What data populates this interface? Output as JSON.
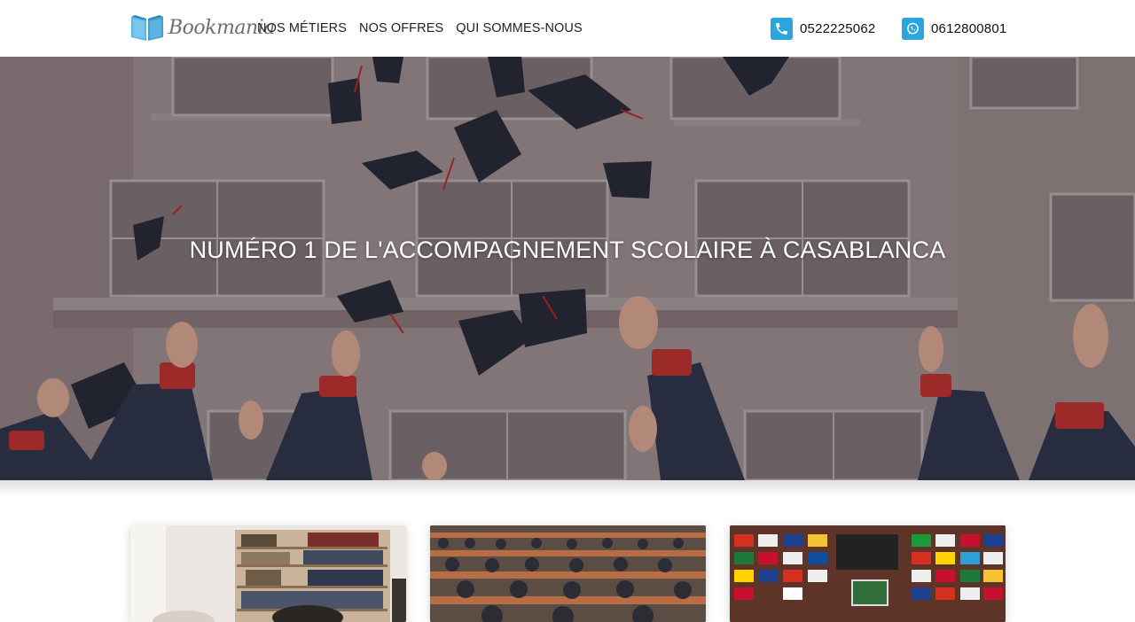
{
  "header": {
    "logo": {
      "text": "Bookmania",
      "icon": "book-logo-icon"
    },
    "nav": [
      {
        "label": "NOS MÉTIERS"
      },
      {
        "label": "NOS OFFRES"
      },
      {
        "label": "QUI SOMMES-NOUS"
      }
    ],
    "contacts": [
      {
        "icon": "phone-icon",
        "number": "0522225062"
      },
      {
        "icon": "whatsapp-icon",
        "number": "0612800801"
      }
    ]
  },
  "hero": {
    "title": "NUMÉRO 1 DE L'ACCOMPAGNEMENT SCOLAIRE À CASABLANCA",
    "image": "graduation-caps-thrown-photo"
  },
  "cards": [
    {
      "image": "library-study-photo"
    },
    {
      "image": "lecture-hall-photo"
    },
    {
      "image": "flags-wall-photo"
    }
  ],
  "colors": {
    "accent": "#2aa5de",
    "text": "#222222",
    "hero_text": "#ffffff"
  }
}
